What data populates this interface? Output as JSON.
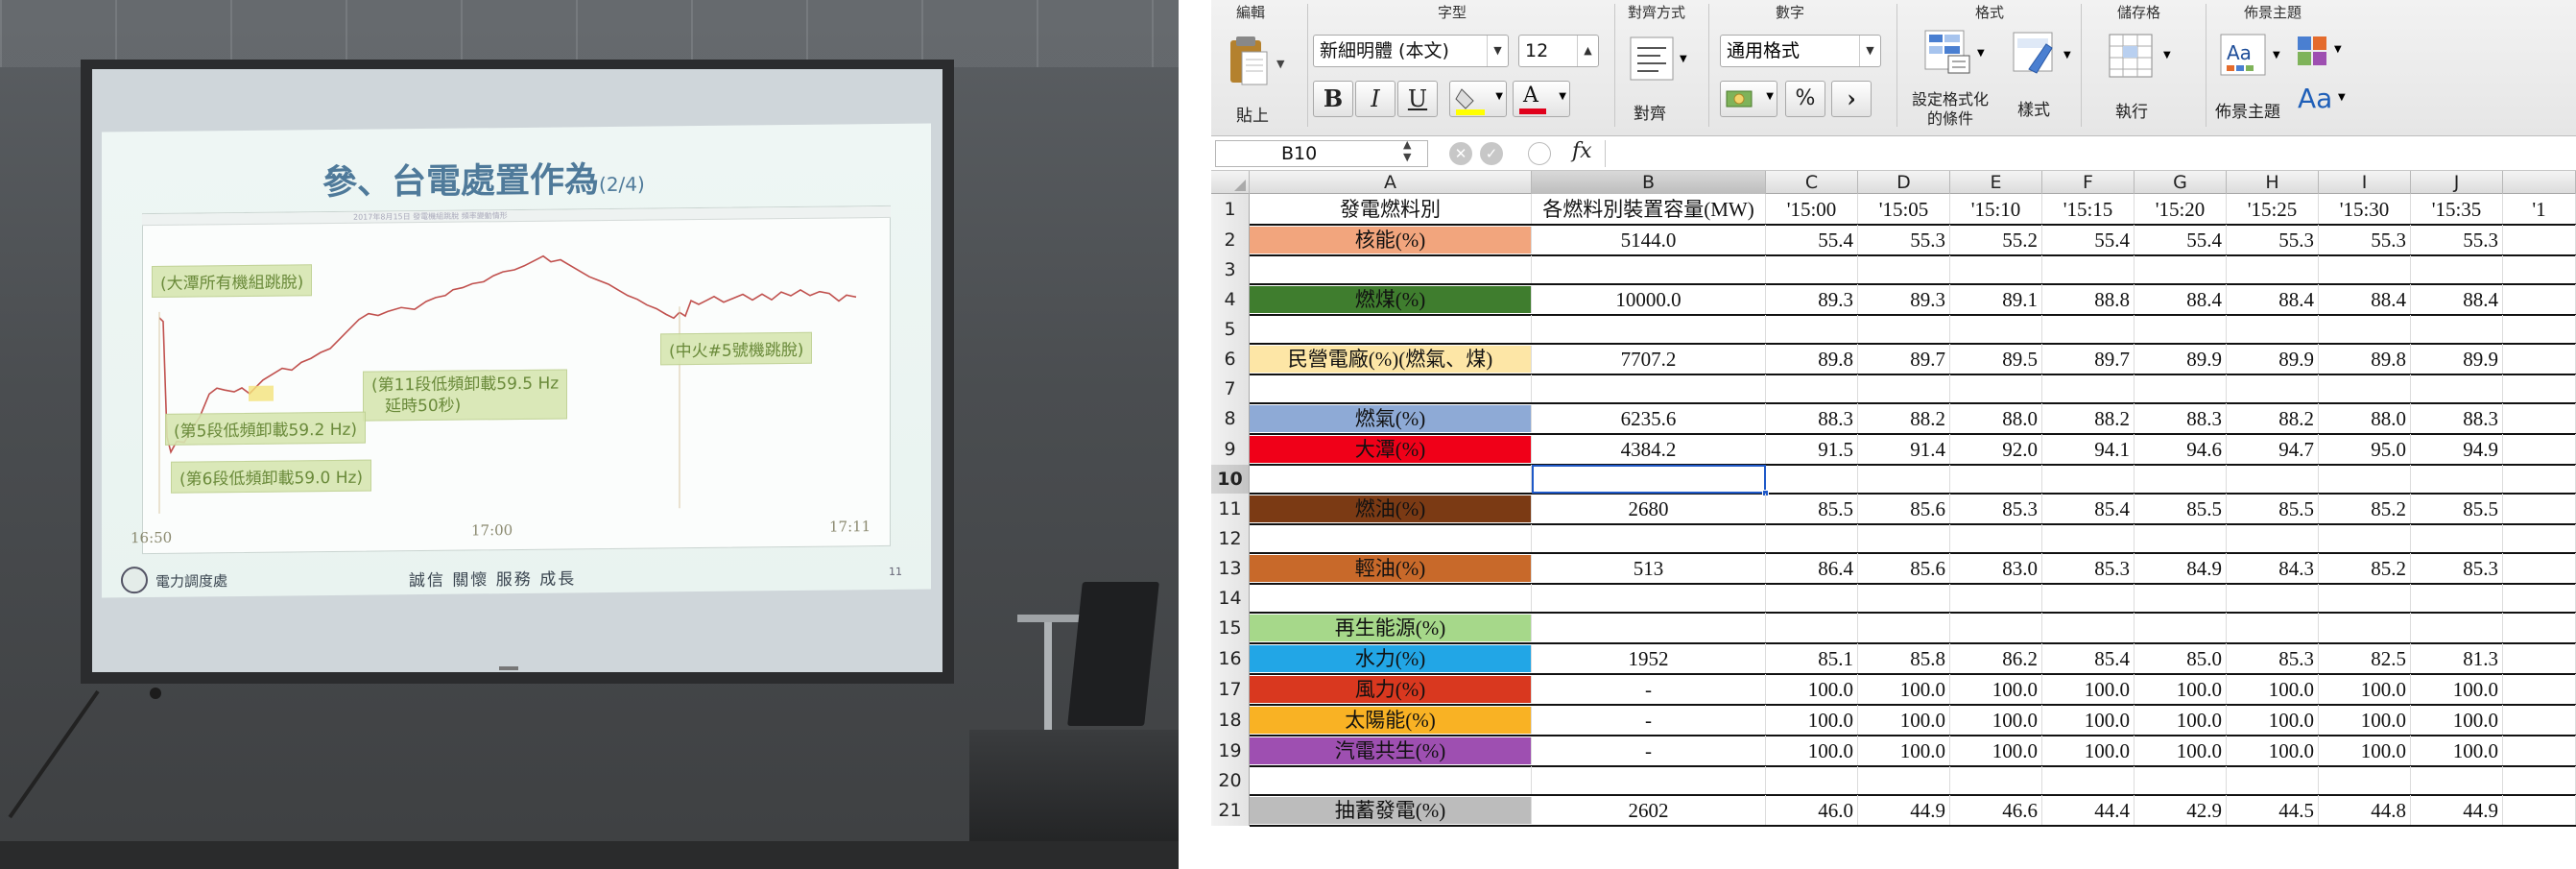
{
  "slide": {
    "title": "參、台電處置作為",
    "title_suffix": "(2/4)",
    "chart_header": "2017年8月15日 發電機組跳脫  頻率變動情形",
    "callouts": {
      "daten": "(大潭所有機組跳脫)",
      "step11_line1": "(第11段低頻卸載59.5 Hz",
      "step11_line2": "延時50秒)",
      "step5": "(第5段低頻卸載59.2 Hz)",
      "step6": "(第6段低頻卸載59.0 Hz)",
      "taichung": "(中火#5號機跳脫)"
    },
    "time_start": "16:50",
    "time_mid": "17:00",
    "time_end": "17:11",
    "footer_org": "電力調度處",
    "footer_motto": "誠信 關懷 服務 成長",
    "footer_page": "11"
  },
  "ribbon": {
    "groups": {
      "edit": "編輯",
      "font": "字型",
      "align": "對齊方式",
      "number": "數字",
      "format": "格式",
      "cells": "儲存格",
      "themes": "佈景主題"
    },
    "paste_label": "貼上",
    "font_name": "新細明體 (本文)",
    "font_size": "12",
    "bold": "B",
    "italic": "I",
    "underline": "U",
    "align_label": "對齊",
    "number_format": "通用格式",
    "percent": "%",
    "comma": "›",
    "cond_format_line1": "設定格式化",
    "cond_format_line2": "的條件",
    "styles_label": "樣式",
    "cells_label": "執行",
    "themes_label": "佈景主題",
    "aa_label": "Aa"
  },
  "formula_bar": {
    "name_box": "B10",
    "fx": "fx",
    "value": ""
  },
  "colors": {
    "nuclear": "#f2a57d",
    "coal": "#3f7d2e",
    "ipp": "#fde6a6",
    "gas": "#8eaad6",
    "datan": "#f00018",
    "fuel_oil": "#7b3a14",
    "diesel": "#c8692a",
    "renewable": "#a6d88a",
    "hydro": "#22a6e6",
    "wind": "#d9381f",
    "solar": "#f9b224",
    "cogen": "#9e4fb1",
    "pumped": "#bcbcbc",
    "selection": "#1f59c8"
  },
  "sheet": {
    "columns": [
      "A",
      "B",
      "C",
      "D",
      "E",
      "F",
      "G",
      "H",
      "I",
      "J",
      ""
    ],
    "selected_column": "B",
    "selected_row": "10",
    "header": [
      "發電燃料別",
      "各燃料別裝置容量(MW)",
      "'15:00",
      "'15:05",
      "'15:10",
      "'15:15",
      "'15:20",
      "'15:25",
      "'15:30",
      "'15:35",
      "'1"
    ],
    "rows": [
      {
        "num": "2",
        "label": "核能(%)",
        "color": "nuclear",
        "cap": "5144.0",
        "vals": [
          "55.4",
          "55.3",
          "55.2",
          "55.4",
          "55.4",
          "55.3",
          "55.3",
          "55.3"
        ]
      },
      {
        "num": "3",
        "label": "",
        "color": "",
        "cap": "",
        "vals": []
      },
      {
        "num": "4",
        "label": "燃煤(%)",
        "color": "coal",
        "cap": "10000.0",
        "vals": [
          "89.3",
          "89.3",
          "89.1",
          "88.8",
          "88.4",
          "88.4",
          "88.4",
          "88.4"
        ]
      },
      {
        "num": "5",
        "label": "",
        "color": "",
        "cap": "",
        "vals": []
      },
      {
        "num": "6",
        "label": "民營電廠(%)(燃氣、煤)",
        "color": "ipp",
        "cap": "7707.2",
        "vals": [
          "89.8",
          "89.7",
          "89.5",
          "89.7",
          "89.9",
          "89.9",
          "89.8",
          "89.9"
        ]
      },
      {
        "num": "7",
        "label": "",
        "color": "",
        "cap": "",
        "vals": []
      },
      {
        "num": "8",
        "label": "燃氣(%)",
        "color": "gas",
        "cap": "6235.6",
        "vals": [
          "88.3",
          "88.2",
          "88.0",
          "88.2",
          "88.3",
          "88.2",
          "88.0",
          "88.3"
        ]
      },
      {
        "num": "9",
        "label": "大潭(%)",
        "color": "datan",
        "cap": "4384.2",
        "vals": [
          "91.5",
          "91.4",
          "92.0",
          "94.1",
          "94.6",
          "94.7",
          "95.0",
          "94.9"
        ]
      },
      {
        "num": "10",
        "label": "",
        "color": "",
        "cap": "",
        "vals": []
      },
      {
        "num": "11",
        "label": "燃油(%)",
        "color": "fuel_oil",
        "cap": "2680",
        "vals": [
          "85.5",
          "85.6",
          "85.3",
          "85.4",
          "85.5",
          "85.5",
          "85.2",
          "85.5"
        ]
      },
      {
        "num": "12",
        "label": "",
        "color": "",
        "cap": "",
        "vals": []
      },
      {
        "num": "13",
        "label": "輕油(%)",
        "color": "diesel",
        "cap": "513",
        "vals": [
          "86.4",
          "85.6",
          "83.0",
          "85.3",
          "84.9",
          "84.3",
          "85.2",
          "85.3"
        ]
      },
      {
        "num": "14",
        "label": "",
        "color": "",
        "cap": "",
        "vals": []
      },
      {
        "num": "15",
        "label": "再生能源(%)",
        "color": "renewable",
        "cap": "",
        "vals": []
      },
      {
        "num": "16",
        "label": "水力(%)",
        "color": "hydro",
        "cap": "1952",
        "vals": [
          "85.1",
          "85.8",
          "86.2",
          "85.4",
          "85.0",
          "85.3",
          "82.5",
          "81.3"
        ]
      },
      {
        "num": "17",
        "label": "風力(%)",
        "color": "wind",
        "cap": "-",
        "vals": [
          "100.0",
          "100.0",
          "100.0",
          "100.0",
          "100.0",
          "100.0",
          "100.0",
          "100.0"
        ]
      },
      {
        "num": "18",
        "label": "太陽能(%)",
        "color": "solar",
        "cap": "-",
        "vals": [
          "100.0",
          "100.0",
          "100.0",
          "100.0",
          "100.0",
          "100.0",
          "100.0",
          "100.0"
        ]
      },
      {
        "num": "19",
        "label": "汽電共生(%)",
        "color": "cogen",
        "cap": "-",
        "vals": [
          "100.0",
          "100.0",
          "100.0",
          "100.0",
          "100.0",
          "100.0",
          "100.0",
          "100.0"
        ]
      },
      {
        "num": "20",
        "label": "",
        "color": "",
        "cap": "",
        "vals": []
      },
      {
        "num": "21",
        "label": "抽蓄發電(%)",
        "color": "pumped",
        "cap": "2602",
        "vals": [
          "46.0",
          "44.9",
          "46.6",
          "44.4",
          "42.9",
          "44.5",
          "44.8",
          "44.9"
        ]
      }
    ]
  }
}
